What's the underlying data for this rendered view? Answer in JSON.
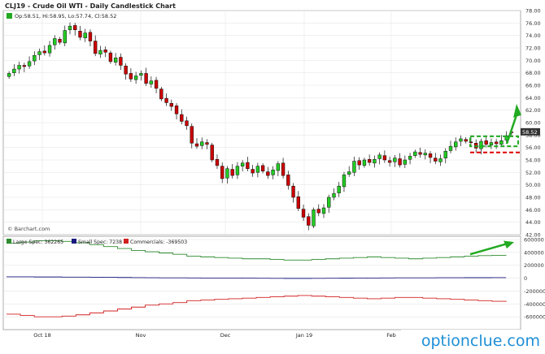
{
  "header": {
    "title": "CLJ19 - Crude Oil WTI - Daily Candlestick Chart",
    "ohlc": "Op:58.51, Hi:58.95, Lo:57.74, Cl:58.52"
  },
  "watermarks": {
    "barchart": "© Barchart.com",
    "optionclue": "optionclue.com"
  },
  "colors": {
    "up_candle": "#22cc22",
    "down_candle": "#cc0000",
    "large_spec": "#2e8b2e",
    "small_spec": "#1a1a80",
    "commercials": "#d22020",
    "arrow": "#22aa22",
    "box_green": "#22aa22",
    "box_red": "#dd0000",
    "price_tag": "#333333"
  },
  "chart_data": [
    {
      "type": "candlestick",
      "title": "CLJ19 - Crude Oil WTI - Daily Candlestick Chart",
      "ylim": [
        42,
        78
      ],
      "y_ticks": [
        42,
        44,
        46,
        48,
        50,
        52,
        54,
        56,
        58,
        60,
        62,
        64,
        66,
        68,
        70,
        72,
        74,
        76,
        78
      ],
      "y_tick_labels": [
        "42.00",
        "44.00",
        "46.00",
        "48.00",
        "50.00",
        "52.00",
        "54.00",
        "56.00",
        "58.00",
        "60.00",
        "62.00",
        "64.00",
        "66.00",
        "68.00",
        "70.00",
        "72.00",
        "74.00",
        "76.00",
        "78.00"
      ],
      "last_price_label": "58.52",
      "last_price": 58.52,
      "x_axis_labels": [
        "Oct 18",
        "Nov",
        "Dec",
        "Jan 19",
        "Feb"
      ],
      "grid": true,
      "annotations": {
        "green_box_levels": [
          56.2,
          57.8
        ],
        "red_line_level": 55.2
      },
      "closes": [
        67.9,
        68.6,
        69.2,
        69.0,
        69.8,
        70.8,
        71.4,
        71.2,
        72.4,
        73.5,
        72.9,
        74.8,
        75.5,
        74.9,
        73.7,
        74.4,
        73.1,
        71.1,
        71.6,
        71.3,
        69.8,
        70.4,
        69.2,
        67.8,
        67.0,
        67.5,
        67.9,
        66.3,
        66.7,
        65.5,
        63.8,
        63.2,
        62.6,
        61.4,
        60.2,
        59.5,
        56.7,
        56.2,
        56.9,
        56.5,
        54.0,
        53.1,
        51.0,
        52.6,
        51.5,
        53.0,
        53.5,
        52.6,
        51.9,
        53.0,
        52.2,
        51.5,
        52.4,
        53.4,
        51.5,
        49.9,
        48.0,
        46.2,
        44.8,
        43.5,
        46.0,
        45.5,
        46.3,
        48.0,
        48.6,
        49.8,
        51.6,
        52.1,
        53.8,
        53.2,
        54.0,
        53.6,
        54.1,
        54.8,
        54.0,
        53.6,
        54.3,
        53.2,
        54.0,
        54.6,
        55.3,
        54.9,
        55.1,
        54.4,
        53.8,
        54.2,
        55.4,
        56.2,
        56.9,
        57.4,
        57.0,
        56.8,
        55.9,
        57.0,
        56.5,
        56.8,
        56.6,
        57.1,
        57.9,
        58.5
      ],
      "opens": [
        67.4,
        68.0,
        68.6,
        69.2,
        69.1,
        69.9,
        70.9,
        71.5,
        71.2,
        72.5,
        73.4,
        72.8,
        74.9,
        75.6,
        74.7,
        73.6,
        74.5,
        73.1,
        71.0,
        71.7,
        71.2,
        69.7,
        70.5,
        69.1,
        67.9,
        66.9,
        67.6,
        67.9,
        66.2,
        66.8,
        65.4,
        63.9,
        63.1,
        62.7,
        61.3,
        60.3,
        59.4,
        56.6,
        56.3,
        56.8,
        56.4,
        54.1,
        53.0,
        51.1,
        52.5,
        51.6,
        53.0,
        53.6,
        52.5,
        52.0,
        53.1,
        52.1,
        51.6,
        52.3,
        53.5,
        51.6,
        49.8,
        48.1,
        46.1,
        44.9,
        43.4,
        46.1,
        45.4,
        46.4,
        48.0,
        48.7,
        49.7,
        51.7,
        52.0,
        53.9,
        53.1,
        54.1,
        53.5,
        54.2,
        54.7,
        53.9,
        53.7,
        54.2,
        53.3,
        54.1,
        54.7,
        55.2,
        54.8,
        55.0,
        54.3,
        53.7,
        54.3,
        55.5,
        56.1,
        57.0,
        57.3,
        56.9,
        56.7,
        55.8,
        57.1,
        56.4,
        56.9,
        56.5,
        57.2,
        58.51
      ],
      "highs_offset": 0.6,
      "lows_offset": 0.6
    },
    {
      "type": "line",
      "title": "",
      "ylim": [
        -800000,
        650000
      ],
      "y_ticks": [
        600000,
        400000,
        200000,
        0,
        -200000,
        -400000,
        -600000
      ],
      "y_tick_labels": [
        "600000",
        "400000",
        "200000",
        "0",
        "-200000",
        "-400000",
        "-600000"
      ],
      "legend": [
        {
          "name": "Large Spec: 362265",
          "color": "#2e8b2e"
        },
        {
          "name": "Small Spec: 7238",
          "color": "#1a1a80"
        },
        {
          "name": "Commercials: -369503",
          "color": "#d22020"
        }
      ],
      "series": [
        {
          "name": "Large Spec",
          "values": [
            540000,
            560000,
            580000,
            580000,
            570000,
            550000,
            520000,
            490000,
            460000,
            430000,
            410000,
            390000,
            370000,
            340000,
            330000,
            320000,
            310000,
            300000,
            300000,
            290000,
            280000,
            280000,
            290000,
            300000,
            310000,
            320000,
            330000,
            320000,
            310000,
            300000,
            310000,
            320000,
            330000,
            340000,
            350000,
            355000,
            362265
          ]
        },
        {
          "name": "Small Spec",
          "values": [
            20000,
            20000,
            18000,
            18000,
            16000,
            15000,
            14000,
            12000,
            10000,
            8000,
            6000,
            5000,
            4000,
            3000,
            2000,
            2000,
            1000,
            0,
            -2000,
            -3000,
            -4000,
            -4000,
            -3000,
            -2000,
            -1000,
            0,
            2000,
            3000,
            4000,
            5000,
            5000,
            6000,
            6000,
            7000,
            7000,
            7200,
            7238
          ]
        },
        {
          "name": "Commercials",
          "values": [
            -560000,
            -580000,
            -600000,
            -600000,
            -590000,
            -570000,
            -540000,
            -510000,
            -480000,
            -450000,
            -420000,
            -400000,
            -380000,
            -350000,
            -340000,
            -330000,
            -320000,
            -310000,
            -300000,
            -290000,
            -280000,
            -270000,
            -280000,
            -290000,
            -300000,
            -310000,
            -320000,
            -310000,
            -300000,
            -300000,
            -310000,
            -320000,
            -330000,
            -340000,
            -350000,
            -360000,
            -369503
          ]
        }
      ]
    }
  ]
}
